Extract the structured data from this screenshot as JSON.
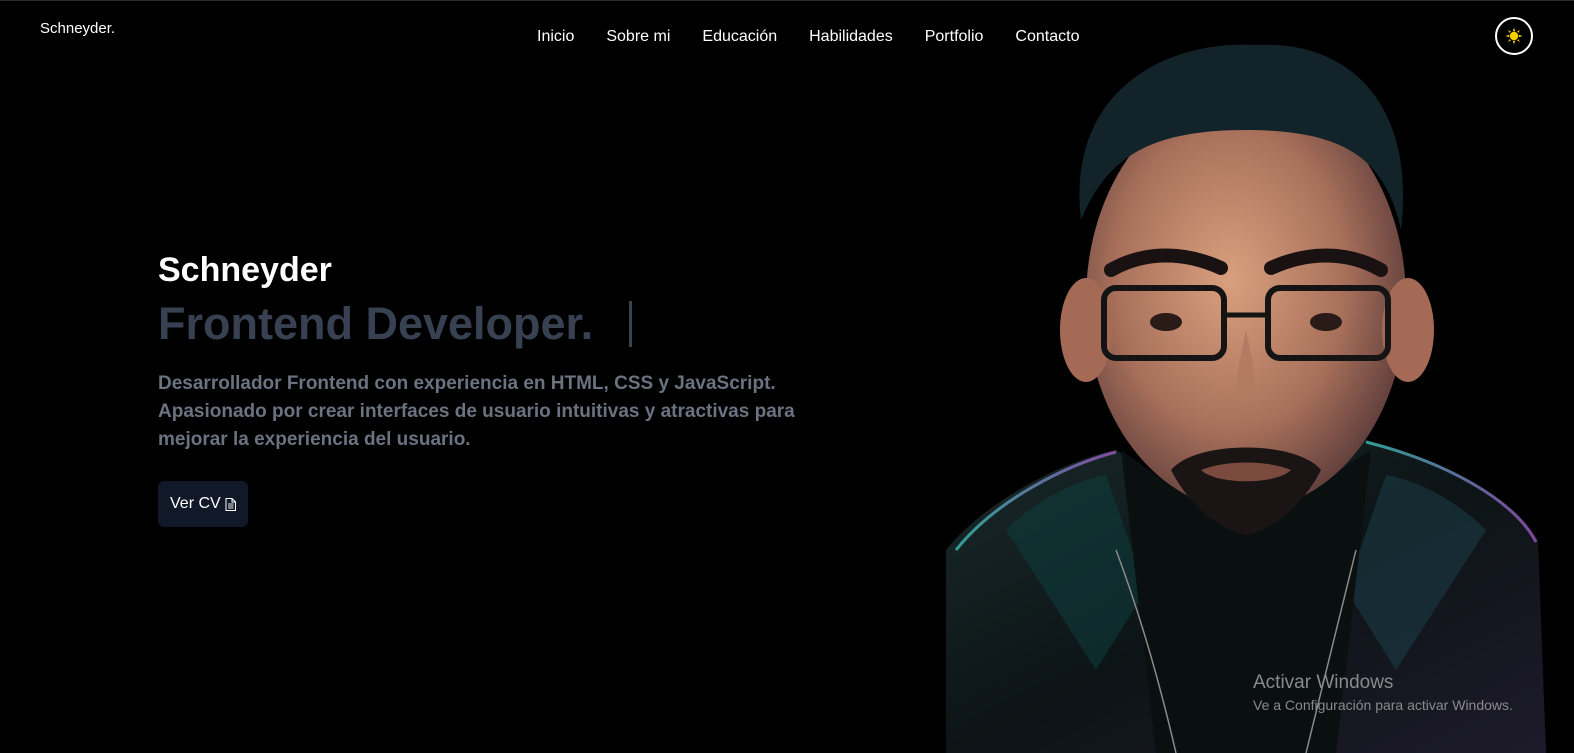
{
  "brand": {
    "logo_text": "Schneyder."
  },
  "nav": {
    "items": [
      {
        "label": "Inicio"
      },
      {
        "label": "Sobre mi"
      },
      {
        "label": "Educación"
      },
      {
        "label": "Habilidades"
      },
      {
        "label": "Portfolio"
      },
      {
        "label": "Contacto"
      }
    ]
  },
  "theme_toggle": {
    "icon": "sun-icon",
    "icon_color": "#f5d000"
  },
  "hero": {
    "name": "Schneyder",
    "role": "Frontend Developer.",
    "description": "Desarrollador Frontend con experiencia en HTML, CSS y JavaScript. Apasionado por crear interfaces de usuario intuitivas y atractivas para mejorar la experiencia del usuario.",
    "cv_button_label": "Ver CV",
    "cv_button_icon": "document-icon"
  },
  "colors": {
    "background": "#000000",
    "role_text": "#374151",
    "description_text": "#6b7280",
    "button_bg": "#111827"
  },
  "watermark": {
    "title": "Activar Windows",
    "subtitle": "Ve a Configuración para activar Windows."
  }
}
